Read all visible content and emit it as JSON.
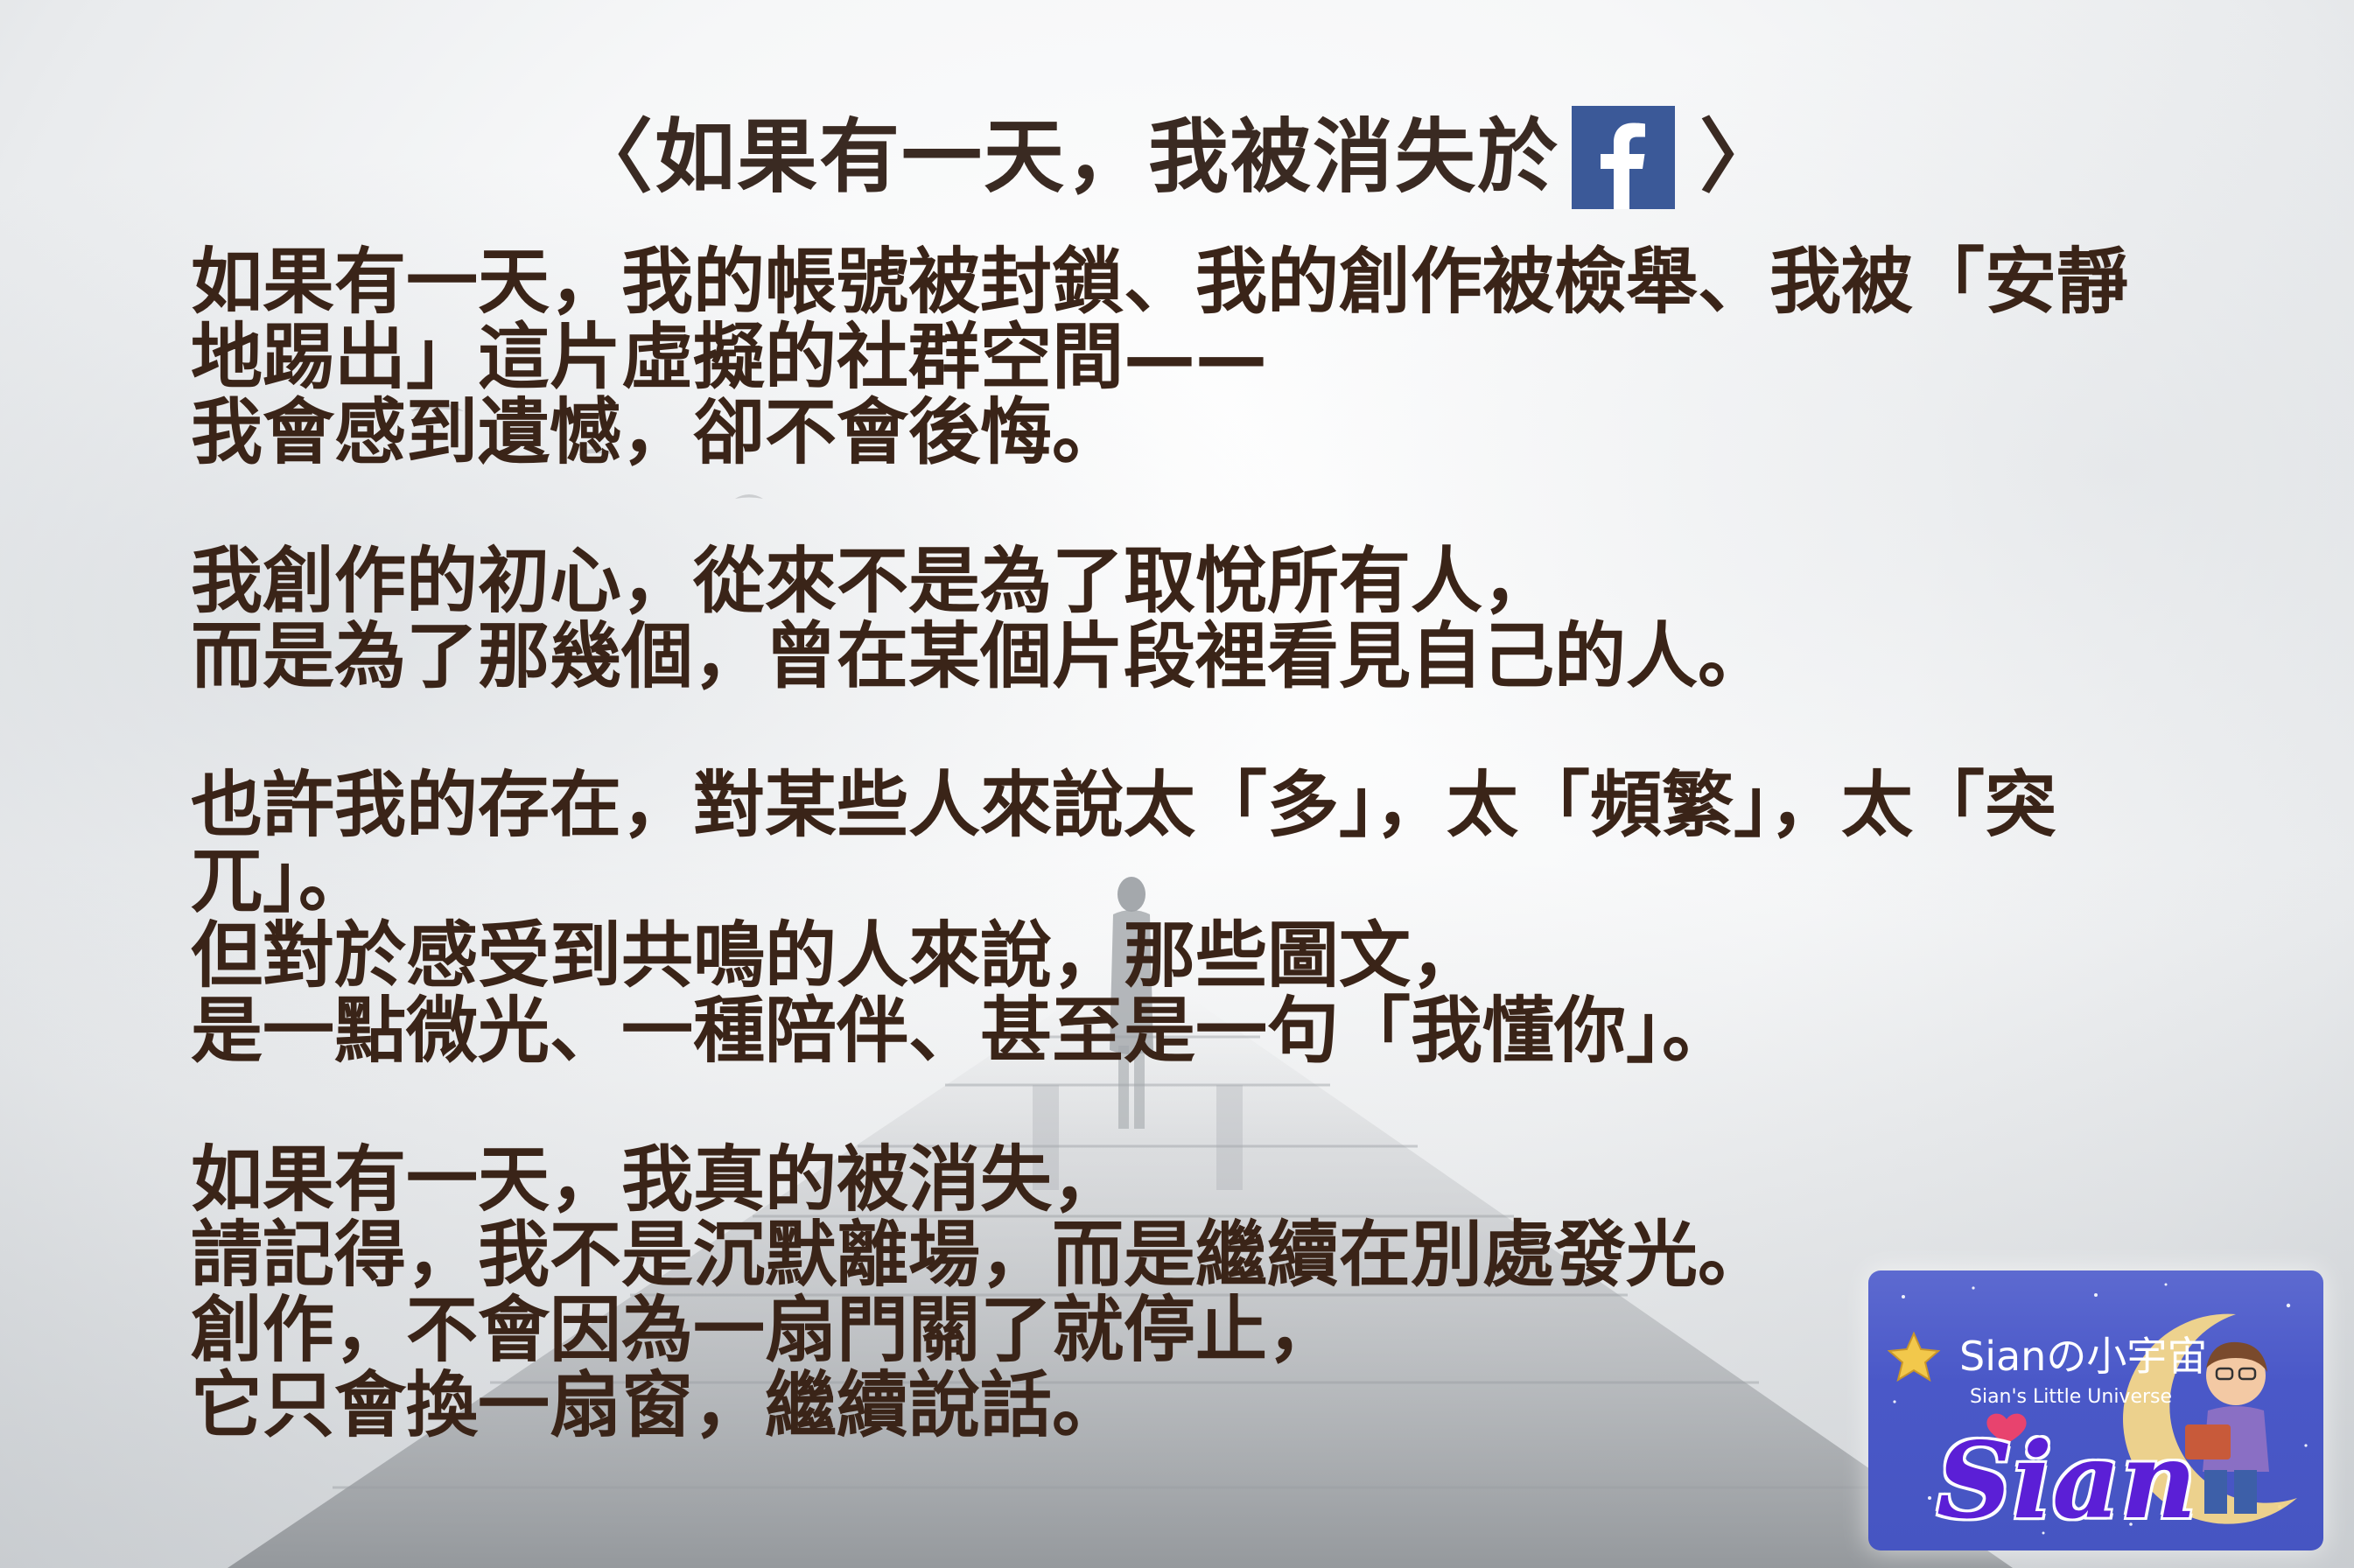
{
  "title": {
    "text": "〈如果有一天，我被消失於",
    "close": "〉",
    "icon": "facebook-icon",
    "icon_color": "#3b5998"
  },
  "paragraphs": [
    {
      "lines": [
        "如果有一天，我的帳號被封鎖、我的創作被檢舉、我被「安靜",
        "地踢出」這片虛擬的社群空間——",
        "我會感到遺憾，卻不會後悔。"
      ]
    },
    {
      "lines": [
        "我創作的初心，從來不是為了取悅所有人，",
        "而是為了那幾個，曾在某個片段裡看見自己的人。"
      ]
    },
    {
      "lines": [
        "也許我的存在，對某些人來說太「多」，太「頻繁」，太「突",
        "兀」。",
        "但對於感受到共鳴的人來說，那些圖文，",
        "是一點微光、一種陪伴、甚至是一句「我懂你」。"
      ]
    },
    {
      "lines": [
        "如果有一天，我真的被消失，",
        "請記得，我不是沉默離場，而是繼續在別處發光。",
        "創作，不會因為一扇門關了就停止，",
        "它只會換一扇窗，繼續說話。"
      ]
    }
  ],
  "logo": {
    "title": "Sianの小宇宙",
    "subtitle": "Sian's Little Universe",
    "signature": "Sian",
    "colors": {
      "background": "#4a58c8",
      "signature": "#5b1fd6"
    }
  },
  "colors": {
    "text": "#3a2418"
  }
}
